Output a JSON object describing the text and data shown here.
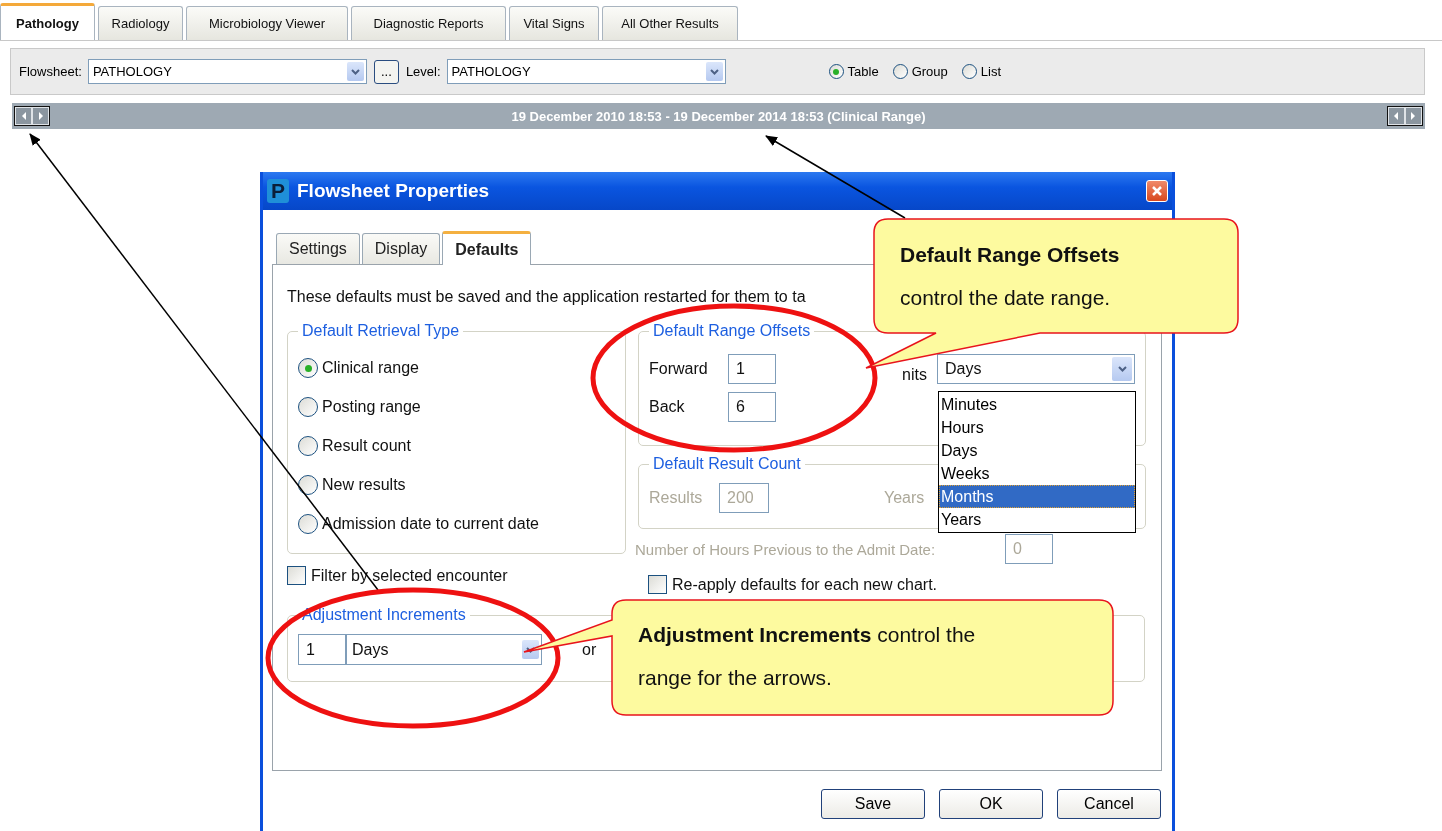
{
  "tabs": [
    {
      "label": "Pathology",
      "selected": true
    },
    {
      "label": "Radiology",
      "selected": false
    },
    {
      "label": "Microbiology Viewer",
      "selected": false
    },
    {
      "label": "Diagnostic Reports",
      "selected": false
    },
    {
      "label": "Vital Signs",
      "selected": false
    },
    {
      "label": "All Other Results",
      "selected": false
    }
  ],
  "toolbar": {
    "flowsheet_label": "Flowsheet:",
    "flowsheet_value": "PATHOLOGY",
    "browse_button": "...",
    "level_label": "Level:",
    "level_value": "PATHOLOGY",
    "view_options": [
      {
        "label": "Table",
        "selected": true
      },
      {
        "label": "Group",
        "selected": false
      },
      {
        "label": "List",
        "selected": false
      }
    ]
  },
  "date_range": "19 December 2010 18:53 - 19 December 2014 18:53 (Clinical Range)",
  "dialog": {
    "app_icon": "P",
    "title": "Flowsheet Properties",
    "tabs": [
      {
        "label": "Settings",
        "selected": false
      },
      {
        "label": "Display",
        "selected": false
      },
      {
        "label": "Defaults",
        "selected": true
      }
    ],
    "description": "These defaults must be saved and the application restarted for them to ta",
    "retrieval_type": {
      "legend": "Default Retrieval Type",
      "options": [
        {
          "label": "Clinical range",
          "selected": true
        },
        {
          "label": "Posting range",
          "selected": false
        },
        {
          "label": "Result count",
          "selected": false
        },
        {
          "label": "New results",
          "selected": false
        },
        {
          "label": "Admission date to current date",
          "selected": false
        }
      ]
    },
    "range_offsets": {
      "legend": "Default Range Offsets",
      "forward_label": "Forward",
      "forward_value": "1",
      "back_label": "Back",
      "back_value": "6",
      "units_label": "nits",
      "units_value": "Days",
      "units_options": [
        {
          "label": "Minutes",
          "selected": false
        },
        {
          "label": "Hours",
          "selected": false
        },
        {
          "label": "Days",
          "selected": false
        },
        {
          "label": "Weeks",
          "selected": false
        },
        {
          "label": "Months",
          "selected": true
        },
        {
          "label": "Years",
          "selected": false
        }
      ]
    },
    "result_count": {
      "legend": "Default Result Count",
      "disabled": true,
      "results_label": "Results",
      "results_value": "200",
      "years_label": "Years"
    },
    "admit_hours": {
      "label": "Number of Hours Previous to the Admit Date:",
      "value": "0",
      "disabled": true
    },
    "filter_encounter": {
      "label": "Filter by selected encounter",
      "checked": false
    },
    "reapply": {
      "label": "Re-apply defaults for each new chart.",
      "checked": false
    },
    "adjustment": {
      "legend": "Adjustment Increments",
      "amount": "1",
      "unit": "Days",
      "or_label": "or"
    },
    "buttons": [
      "Save",
      "OK",
      "Cancel"
    ]
  },
  "callouts": [
    {
      "text": "**Default Range Offsets** control the date range."
    },
    {
      "text": "**Adjustment Increments** control the range for the arrows."
    }
  ]
}
